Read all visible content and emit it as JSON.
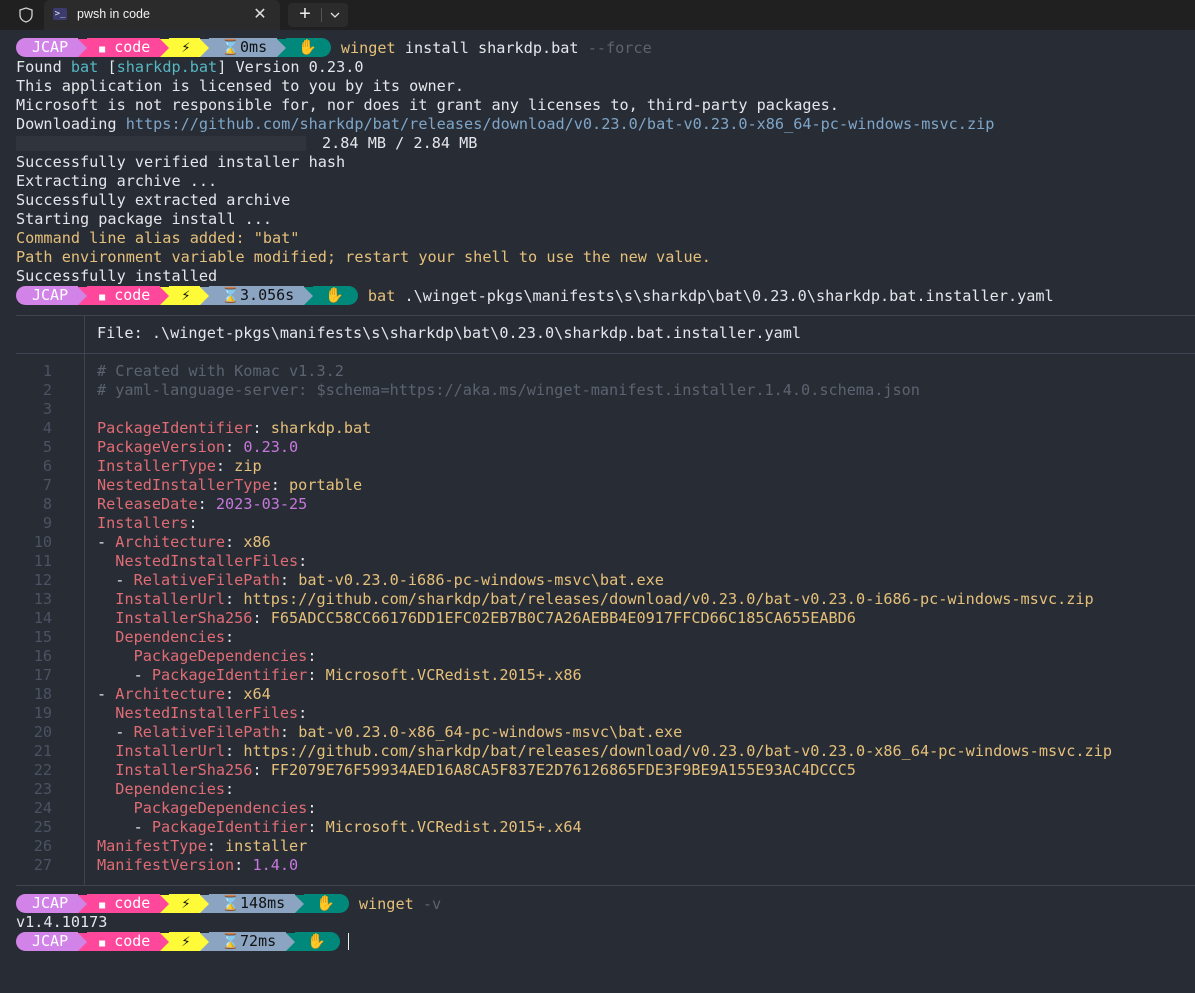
{
  "window": {
    "tab_title": "pwsh in code",
    "tab_icon_glyph": ">_",
    "close_glyph": "✕",
    "new_tab_glyph": "+"
  },
  "prompt_segments": {
    "user": "JCAP",
    "folder_icon": "■",
    "folder": "code",
    "git_icon": "⚡",
    "shell_icon": "✋"
  },
  "commands": [
    {
      "time": "⌛0ms",
      "exe": "winget",
      "args": " install sharkdp.bat ",
      "flag": "--force"
    },
    {
      "time": "⌛3.056s",
      "exe": "bat",
      "args": " .\\winget-pkgs\\manifests\\s\\sharkdp\\bat\\0.23.0\\sharkdp.bat.installer.yaml",
      "flag": ""
    },
    {
      "time": "⌛148ms",
      "exe": "winget",
      "args": " ",
      "flag": "-v"
    },
    {
      "time": "⌛72ms",
      "exe": "",
      "args": "",
      "flag": ""
    }
  ],
  "install_output": {
    "found_prefix": "Found ",
    "found_name": "bat",
    "found_bracket_open": " [",
    "found_id": "sharkdp.bat",
    "found_suffix": "] Version 0.23.0",
    "license_line": "This application is licensed to you by its owner.",
    "ms_line": "Microsoft is not responsible for, nor does it grant any licenses to, third-party packages.",
    "downloading_label": "Downloading ",
    "download_url": "https://github.com/sharkdp/bat/releases/download/v0.23.0/bat-v0.23.0-x86_64-pc-windows-msvc.zip",
    "progress_fraction": 1.0,
    "progress_text": "2.84 MB / 2.84 MB",
    "verified": "Successfully verified installer hash",
    "extracting": "Extracting archive ...",
    "extracted": "Successfully extracted archive",
    "starting": "Starting package install ...",
    "alias": "Command line alias added: \"bat\"",
    "path_env": "Path environment variable modified; restart your shell to use the new value.",
    "installed": "Successfully installed"
  },
  "bat_view": {
    "file_label": "File: .\\winget-pkgs\\manifests\\s\\sharkdp\\bat\\0.23.0\\sharkdp.bat.installer.yaml",
    "line_numbers": [
      "1",
      "2",
      "3",
      "4",
      "5",
      "6",
      "7",
      "8",
      "9",
      "10",
      "11",
      "12",
      "13",
      "14",
      "15",
      "16",
      "17",
      "18",
      "19",
      "20",
      "21",
      "22",
      "23",
      "24",
      "25",
      "26",
      "27"
    ],
    "lines": [
      [
        [
          "c",
          "# Created with Komac v1.3.2"
        ]
      ],
      [
        [
          "c",
          "# yaml-language-server: $schema=https://aka.ms/winget-manifest.installer.1.4.0.schema.json"
        ]
      ],
      [],
      [
        [
          "k",
          "PackageIdentifier"
        ],
        [
          "p",
          ": "
        ],
        [
          "s",
          "sharkdp.bat"
        ]
      ],
      [
        [
          "k",
          "PackageVersion"
        ],
        [
          "p",
          ": "
        ],
        [
          "n",
          "0.23.0"
        ]
      ],
      [
        [
          "k",
          "InstallerType"
        ],
        [
          "p",
          ": "
        ],
        [
          "s",
          "zip"
        ]
      ],
      [
        [
          "k",
          "NestedInstallerType"
        ],
        [
          "p",
          ": "
        ],
        [
          "s",
          "portable"
        ]
      ],
      [
        [
          "k",
          "ReleaseDate"
        ],
        [
          "p",
          ": "
        ],
        [
          "n",
          "2023-03-25"
        ]
      ],
      [
        [
          "k",
          "Installers"
        ],
        [
          "p",
          ":"
        ]
      ],
      [
        [
          "p",
          "- "
        ],
        [
          "k",
          "Architecture"
        ],
        [
          "p",
          ": "
        ],
        [
          "s",
          "x86"
        ]
      ],
      [
        [
          "p",
          "  "
        ],
        [
          "k",
          "NestedInstallerFiles"
        ],
        [
          "p",
          ":"
        ]
      ],
      [
        [
          "p",
          "  - "
        ],
        [
          "k",
          "RelativeFilePath"
        ],
        [
          "p",
          ": "
        ],
        [
          "s",
          "bat-v0.23.0-i686-pc-windows-msvc\\bat.exe"
        ]
      ],
      [
        [
          "p",
          "  "
        ],
        [
          "k",
          "InstallerUrl"
        ],
        [
          "p",
          ": "
        ],
        [
          "s",
          "https://github.com/sharkdp/bat/releases/download/v0.23.0/bat-v0.23.0-i686-pc-windows-msvc.zip"
        ]
      ],
      [
        [
          "p",
          "  "
        ],
        [
          "k",
          "InstallerSha256"
        ],
        [
          "p",
          ": "
        ],
        [
          "s",
          "F65ADCC58CC66176DD1EFC02EB7B0C7A26AEBB4E0917FFCD66C185CA655EABD6"
        ]
      ],
      [
        [
          "p",
          "  "
        ],
        [
          "k",
          "Dependencies"
        ],
        [
          "p",
          ":"
        ]
      ],
      [
        [
          "p",
          "    "
        ],
        [
          "k",
          "PackageDependencies"
        ],
        [
          "p",
          ":"
        ]
      ],
      [
        [
          "p",
          "    - "
        ],
        [
          "k",
          "PackageIdentifier"
        ],
        [
          "p",
          ": "
        ],
        [
          "s",
          "Microsoft.VCRedist.2015+.x86"
        ]
      ],
      [
        [
          "p",
          "- "
        ],
        [
          "k",
          "Architecture"
        ],
        [
          "p",
          ": "
        ],
        [
          "s",
          "x64"
        ]
      ],
      [
        [
          "p",
          "  "
        ],
        [
          "k",
          "NestedInstallerFiles"
        ],
        [
          "p",
          ":"
        ]
      ],
      [
        [
          "p",
          "  - "
        ],
        [
          "k",
          "RelativeFilePath"
        ],
        [
          "p",
          ": "
        ],
        [
          "s",
          "bat-v0.23.0-x86_64-pc-windows-msvc\\bat.exe"
        ]
      ],
      [
        [
          "p",
          "  "
        ],
        [
          "k",
          "InstallerUrl"
        ],
        [
          "p",
          ": "
        ],
        [
          "s",
          "https://github.com/sharkdp/bat/releases/download/v0.23.0/bat-v0.23.0-x86_64-pc-windows-msvc.zip"
        ]
      ],
      [
        [
          "p",
          "  "
        ],
        [
          "k",
          "InstallerSha256"
        ],
        [
          "p",
          ": "
        ],
        [
          "s",
          "FF2079E76F59934AED16A8CA5F837E2D76126865FDE3F9BE9A155E93AC4DCCC5"
        ]
      ],
      [
        [
          "p",
          "  "
        ],
        [
          "k",
          "Dependencies"
        ],
        [
          "p",
          ":"
        ]
      ],
      [
        [
          "p",
          "    "
        ],
        [
          "k",
          "PackageDependencies"
        ],
        [
          "p",
          ":"
        ]
      ],
      [
        [
          "p",
          "    - "
        ],
        [
          "k",
          "PackageIdentifier"
        ],
        [
          "p",
          ": "
        ],
        [
          "s",
          "Microsoft.VCRedist.2015+.x64"
        ]
      ],
      [
        [
          "k",
          "ManifestType"
        ],
        [
          "p",
          ": "
        ],
        [
          "s",
          "installer"
        ]
      ],
      [
        [
          "k",
          "ManifestVersion"
        ],
        [
          "p",
          ": "
        ],
        [
          "n",
          "1.4.0"
        ]
      ]
    ]
  },
  "winget_version_output": "v1.4.10173"
}
